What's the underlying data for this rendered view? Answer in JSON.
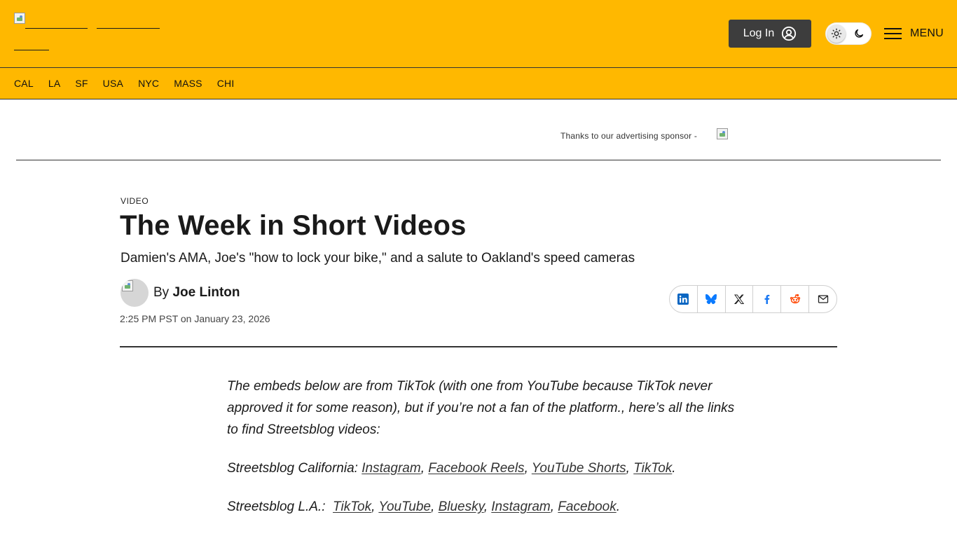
{
  "header": {
    "login_label": "Log In",
    "menu_label": "MENU",
    "brand_color": "#FFB800"
  },
  "nav": {
    "items": [
      "CAL",
      "LA",
      "SF",
      "USA",
      "NYC",
      "MASS",
      "CHI"
    ]
  },
  "ad": {
    "text": "Thanks to our advertising sponsor -"
  },
  "article": {
    "kicker": "VIDEO",
    "title": "The Week in Short Videos",
    "dek": "Damien's AMA, Joe's \"how to lock your bike,\" and a salute to Oakland's speed cameras",
    "byline_prefix": "By ",
    "author": "Joe Linton",
    "date": "2:25 PM PST on January 23, 2026",
    "share": [
      "linkedin-icon",
      "bluesky-icon",
      "x-icon",
      "facebook-icon",
      "reddit-icon",
      "email-icon"
    ]
  },
  "body": {
    "intro": "The embeds below are from TikTok (with one from YouTube because TikTok never approved it for some reason), but if you’re not a fan of the platform., here’s all the links to find Streetsblog videos:",
    "california": {
      "label": "Streetsblog California: ",
      "links": [
        "Instagram",
        "Facebook Reels",
        "YouTube Shorts",
        "TikTok"
      ]
    },
    "la": {
      "label": "Streetsblog L.A.:  ",
      "links": [
        "TikTok",
        "YouTube",
        "Bluesky",
        "Instagram",
        "Facebook"
      ]
    }
  }
}
